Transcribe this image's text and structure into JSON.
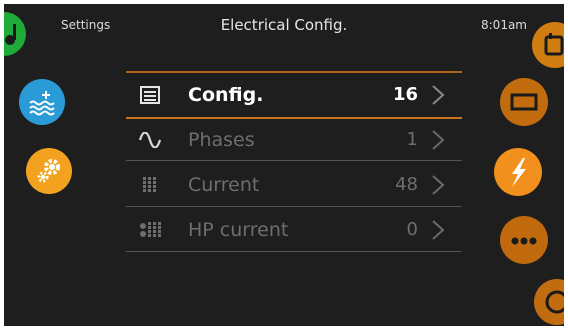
{
  "header": {
    "left_label": "Settings",
    "title": "Electrical Config.",
    "time": "8:01am"
  },
  "left_nav": [
    {
      "name": "water-icon",
      "color": "#2a9bd6"
    },
    {
      "name": "gear-icon",
      "color": "#f2a21e"
    }
  ],
  "right_nav": [
    {
      "name": "calendar-icon",
      "color": "#d07d12"
    },
    {
      "name": "battery-icon",
      "color": "#c06c0f"
    },
    {
      "name": "lightning-icon",
      "color": "#f2901e"
    },
    {
      "name": "more-icon",
      "color": "#c0690d"
    },
    {
      "name": "power-icon",
      "color": "#c06c0f"
    }
  ],
  "menu": [
    {
      "label": "Config.",
      "value": "16",
      "icon": "list-icon",
      "active": true
    },
    {
      "label": "Phases",
      "value": "1",
      "icon": "sine-wave-icon",
      "active": false
    },
    {
      "label": "Current",
      "value": "48",
      "icon": "grid-icon",
      "active": false
    },
    {
      "label": "HP current",
      "value": "0",
      "icon": "hp-grid-icon",
      "active": false
    }
  ],
  "colors": {
    "accent_orange": "#c8741c",
    "background": "#1e1e1e",
    "green": "#1faa3a"
  }
}
